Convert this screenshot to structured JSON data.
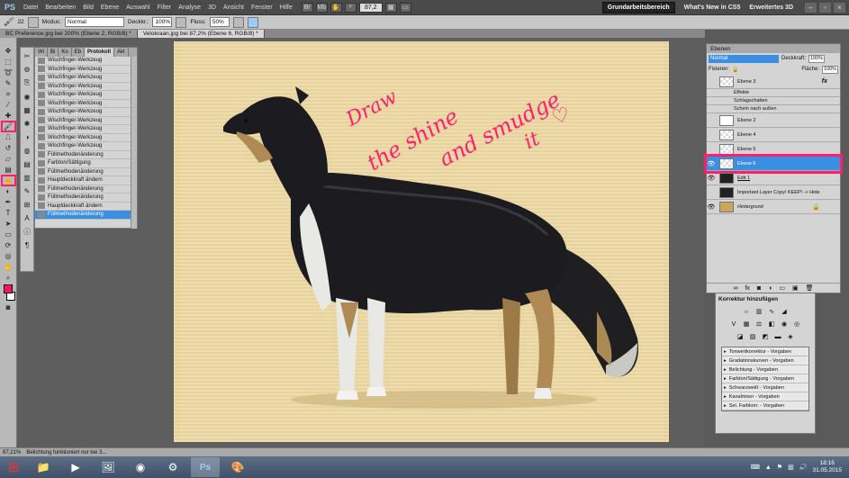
{
  "app": {
    "logo": "PS"
  },
  "menu": [
    "Datei",
    "Bearbeiten",
    "Bild",
    "Ebene",
    "Auswahl",
    "Filter",
    "Analyse",
    "3D",
    "Ansicht",
    "Fenster",
    "Hilfe"
  ],
  "menu_zoom": "87,2",
  "workspace": {
    "active": "Grundarbeitsbereich",
    "items": [
      "What's New in CS5",
      "Erweitertes 3D"
    ]
  },
  "options": {
    "brush_size": "22",
    "mode_label": "Modus:",
    "mode_value": "Normal",
    "opacity_label": "Deckkr.:",
    "opacity_value": "100%",
    "flow_label": "Fluss:",
    "flow_value": "50%"
  },
  "doc_tabs": [
    {
      "label": "BC Preference.jpg bei 200% (Ebene 2, RGB/8) *",
      "active": false
    },
    {
      "label": "Velokraan.jpg bei 87,2% (Ebene 6, RGB/8) *",
      "active": true
    }
  ],
  "history": {
    "tabs": [
      "Wi",
      "Bi",
      "Ko",
      "Eb",
      "Protokoll",
      "Akt"
    ],
    "active_tab": "Protokoll",
    "items": [
      "Wischfinger-Werkzeug",
      "Wischfinger-Werkzeug",
      "Wischfinger-Werkzeug",
      "Wischfinger-Werkzeug",
      "Wischfinger-Werkzeug",
      "Wischfinger-Werkzeug",
      "Wischfinger-Werkzeug",
      "Wischfinger-Werkzeug",
      "Wischfinger-Werkzeug",
      "Wischfinger-Werkzeug",
      "Wischfinger-Werkzeug",
      "Füllmethodenänderung",
      "Farbton/Sättigung",
      "Füllmethodenänderung",
      "Hauptdeckkraft ändern",
      "Füllmethodenänderung",
      "Füllmethodenänderung",
      "Hauptdeckkraft ändern",
      "Füllmethodenänderung"
    ],
    "active_index": 18
  },
  "annotation": {
    "line1": "Draw",
    "line2": "the shine",
    "line3": "and smudge",
    "line4": "it",
    "color": "#ff1e6e"
  },
  "layers": {
    "title": "Ebenen",
    "blend_mode": "Normal",
    "opacity_label": "Deckkraft:",
    "opacity_value": "100%",
    "lock_label": "Fixieren:",
    "fill_label": "Fläche:",
    "fill_value": "100%",
    "rows": [
      {
        "name": "Ebene 3",
        "fx": "fx",
        "thumb": "checker"
      },
      {
        "name": "Effekte",
        "sub": true
      },
      {
        "name": "Schlagschatten",
        "sub": true
      },
      {
        "name": "Schein nach außen",
        "sub": true
      },
      {
        "name": "Ebene 2",
        "thumb": "white"
      },
      {
        "name": "Ebene 4",
        "thumb": "checker"
      },
      {
        "name": "Ebene 5",
        "thumb": "checker"
      },
      {
        "name": "Ebene 6",
        "thumb": "checker",
        "active": true
      },
      {
        "name": "Edit 1",
        "thumb": "dark"
      },
      {
        "name": "Important Layer Copy! KEEP! -> Hide",
        "thumb": "dark"
      },
      {
        "name": "Hintergrund",
        "thumb": "bg",
        "italic": true,
        "locked": true
      }
    ]
  },
  "adjust": {
    "title": "Korrektur hinzufügen",
    "presets": [
      "Tonwertkorrektur - Vorgaben",
      "Gradationskurven - Vorgaben",
      "Belichtung - Vorgaben",
      "Farbton/Sättigung - Vorgaben",
      "Schwarzweiß - Vorgaben",
      "Kanalmixer - Vorgaben",
      "Sel. Farbkorr. - Vorgaben"
    ]
  },
  "status": {
    "zoom": "87,21%",
    "text": "Belichtung funktioniert nur bei 3..."
  },
  "clock": {
    "time": "18:16",
    "date": "31.05.2015"
  }
}
